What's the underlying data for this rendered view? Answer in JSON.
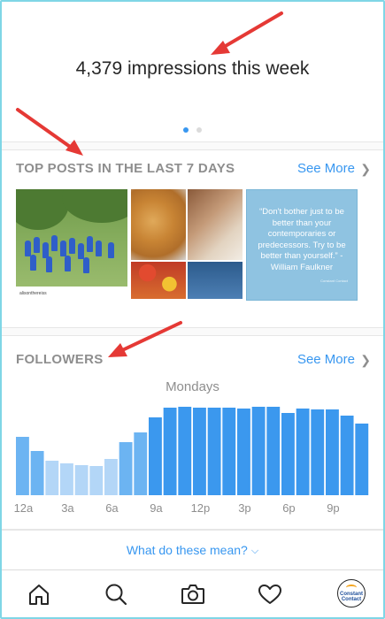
{
  "header": {
    "impressions_text": "4,379 impressions this week",
    "pager_count": 2,
    "pager_active": 0
  },
  "top_posts": {
    "title": "TOP POSTS IN THE LAST 7 DAYS",
    "see_more": "See More",
    "posts": [
      {
        "type": "photo",
        "icon": "group-photo",
        "caption": "alisonthereiss"
      },
      {
        "type": "photo-collage",
        "icon": "food-collage"
      },
      {
        "type": "quote",
        "text": "“Don't bother just to be better than your contemporaries or predecessors. Try to be better than yourself.” -William Faulkner",
        "signature": "Constant Contact"
      }
    ]
  },
  "followers": {
    "title": "FOLLOWERS",
    "see_more": "See More",
    "chart_label": "Mondays",
    "chart_data": {
      "type": "bar",
      "title": "Mondays",
      "categories": [
        "12a",
        "1a",
        "2a",
        "3a",
        "4a",
        "5a",
        "6a",
        "7a",
        "8a",
        "9a",
        "10a",
        "11a",
        "12p",
        "1p",
        "2p",
        "3p",
        "4p",
        "5p",
        "6p",
        "7p",
        "8p",
        "9p",
        "10p",
        "11p"
      ],
      "x_tick_labels": [
        "12a",
        "3a",
        "6a",
        "9a",
        "12p",
        "3p",
        "6p",
        "9p"
      ],
      "values": [
        66,
        50,
        39,
        36,
        34,
        33,
        41,
        60,
        71,
        88,
        99,
        100,
        99,
        99,
        99,
        98,
        100,
        100,
        93,
        98,
        97,
        97,
        90,
        81
      ],
      "ylim": [
        0,
        100
      ],
      "colors": {
        "low": "#b3d6f7",
        "mid": "#6cb4f2",
        "high": "#3b98ee"
      },
      "grid": false
    }
  },
  "footer": {
    "help_link": "What do these mean?"
  },
  "nav": {
    "items": [
      "home-icon",
      "search-icon",
      "camera-icon",
      "heart-icon",
      "profile-avatar"
    ],
    "avatar_text_1": "Constant",
    "avatar_text_2": "Contact"
  },
  "colors": {
    "accent": "#3897f0",
    "annotation_arrow": "#e53935",
    "section_title": "#8e8e8e"
  }
}
